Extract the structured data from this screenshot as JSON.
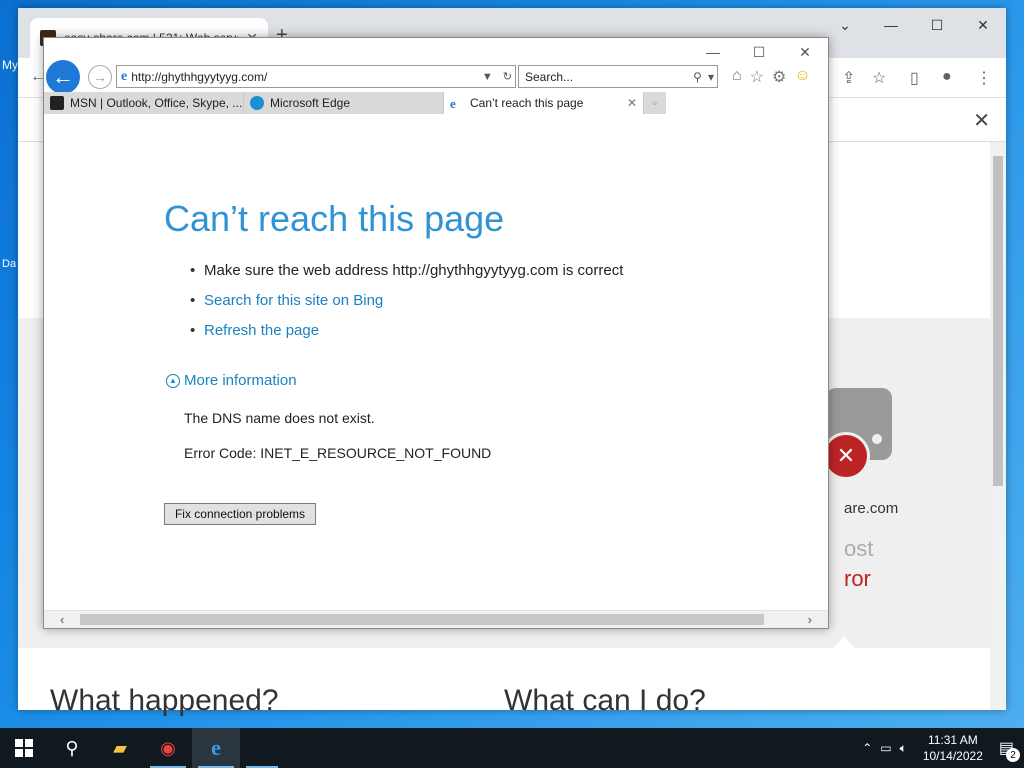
{
  "desktop": {
    "labels": [
      "My",
      "Da"
    ]
  },
  "chrome": {
    "tab_title": "easy-share.com | 521: Web serve",
    "new_tab": "+",
    "heading_left": "What happened?",
    "heading_right": "What can I do?",
    "peek_domain": "are.com",
    "peek_host": "ost",
    "peek_error": "ror"
  },
  "ie": {
    "url": "http://ghythhgyytyyg.com/",
    "search_placeholder": "Search...",
    "tabs": [
      {
        "label": "MSN | Outlook, Office, Skype, ..."
      },
      {
        "label": "Microsoft Edge"
      },
      {
        "label": "Can’t reach this page"
      }
    ],
    "content": {
      "title": "Can’t reach this page",
      "bullets": [
        "Make sure the web address http://ghythhgyytyyg.com is correct",
        "Search for this site on Bing",
        "Refresh the page"
      ],
      "more_info": "More information",
      "dns_msg": "The DNS name does not exist.",
      "error_code": "Error Code: INET_E_RESOURCE_NOT_FOUND",
      "fix_button": "Fix connection problems"
    }
  },
  "taskbar": {
    "time": "11:31 AM",
    "date": "10/14/2022",
    "notifications": "2"
  }
}
